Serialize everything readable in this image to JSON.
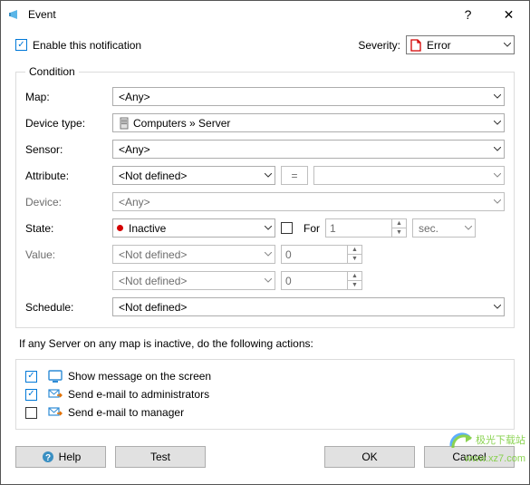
{
  "window": {
    "title": "Event",
    "help_btn": "?",
    "close_btn": "✕"
  },
  "topbar": {
    "enable_label": "Enable this notification",
    "enable_checked": true,
    "severity_label": "Severity:",
    "severity_value": "Error"
  },
  "condition": {
    "legend": "Condition",
    "rows": {
      "map": {
        "label": "Map:",
        "value": "<Any>"
      },
      "devtype": {
        "label": "Device type:",
        "value": "Computers » Server"
      },
      "sensor": {
        "label": "Sensor:",
        "value": "<Any>"
      },
      "attribute": {
        "label": "Attribute:",
        "value": "<Not defined>",
        "op": "=",
        "attr2": ""
      },
      "device": {
        "label": "Device:",
        "value": "<Any>"
      },
      "state": {
        "label": "State:",
        "value": "Inactive",
        "for_label": "For",
        "for_checked": false,
        "for_num": "1",
        "for_unit": "sec."
      },
      "value": {
        "label": "Value:",
        "sel": "<Not defined>",
        "num": "0"
      },
      "value2": {
        "sel": "<Not defined>",
        "num": "0"
      },
      "schedule": {
        "label": "Schedule:",
        "value": "<Not defined>"
      }
    }
  },
  "actions_text": "If any Server on any map is inactive, do the following actions:",
  "actions": [
    {
      "checked": true,
      "label": "Show message on the screen"
    },
    {
      "checked": true,
      "label": "Send e-mail to administrators"
    },
    {
      "checked": false,
      "label": "Send e-mail to manager"
    }
  ],
  "buttons": {
    "help": "Help",
    "test": "Test",
    "ok": "OK",
    "cancel": "Cancel"
  },
  "watermark": {
    "line1": "极光下载站",
    "line2": "www.xz7.com"
  }
}
